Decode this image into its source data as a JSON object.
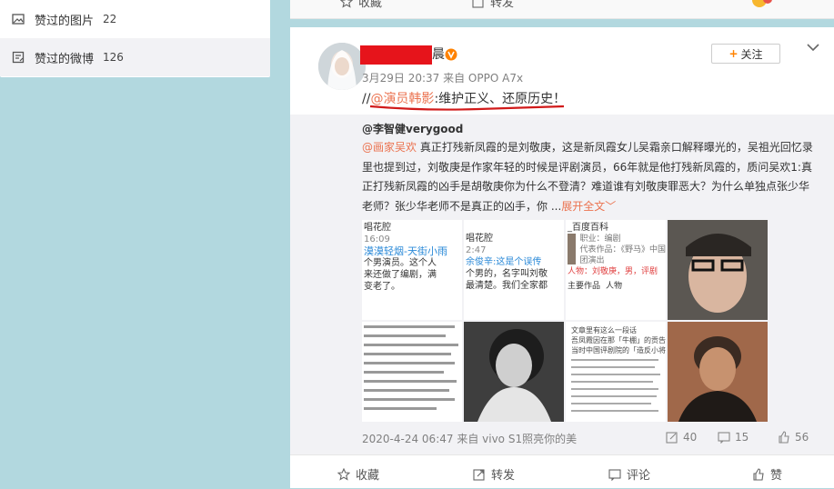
{
  "sidebar": {
    "items": [
      {
        "label": "赞过的图片",
        "count": "22",
        "icon": "image-icon"
      },
      {
        "label": "赞过的微博",
        "count": "126",
        "icon": "post-icon"
      }
    ]
  },
  "prev_card": {
    "favorite_label": "收藏",
    "repost_label": "转发"
  },
  "post": {
    "name_suffix": "晨",
    "meta": "3月29日 20:37 来自 OPPO A7x",
    "follow_label": "关注",
    "text_prefix": "//",
    "mention": "@演员韩影",
    "text_body": ":维护正义、还原历史！",
    "repost": {
      "author": "@李智健verygood",
      "mention": "@画家吴欢",
      "text": " 真正打残新凤霞的是刘敬庚，这是新凤霞女儿吴霜亲口解释曝光的，吴祖光回忆录里也提到过，刘敬庚是作家年轻的时候是评剧演员，66年就是他打残新凤霞的，质问吴欢1:真正打残新凤霞的凶手是胡敬庚你为什么不登清？难道谁有刘敬庚罪恶大？为什么单独点张少华老师？张少华老师不是真正的凶手，你 ...",
      "more_label": "展开全文",
      "more_arrow": "﹀",
      "footer": "2020-4-24 06:47 来自 vivo S1照亮你的美",
      "reposts": "40",
      "comments": "15",
      "likes": "56"
    },
    "thumbs": {
      "t1": {
        "l1": "唱花腔",
        "l2": "16:09",
        "l3": "漠漠轻烟-天街小雨",
        "l4": "个男演员。这个人",
        "l5": "来还做了编剧，满",
        "l6": "变老了。"
      },
      "t2": {
        "l1": "唱花腔",
        "l2": "2:47",
        "l3": "余俊辛:这是个误传",
        "l4": "个男的，名字叫刘敬",
        "l5": "最清楚。我们全家都"
      },
      "t3": {
        "l1": "_百度百科",
        "l2": "职业：编剧",
        "l3": "代表作品：《野马》中国",
        "l4": "团演出",
        "l5": "人物：刘敬庚，男，评剧",
        "l6": "主要作品",
        "l7": "人物"
      },
      "t7": {
        "l1": "文章里有这么一段话",
        "l2": "吾凤霞因在那「牛棚」的贡告，她是",
        "l3": "当时中国评剧院的「造反小将」学习主教"
      }
    },
    "actions": {
      "favorite": "收藏",
      "repost": "转发",
      "comment": "评论",
      "like": "赞"
    }
  },
  "colors": {
    "accent": "#eb7350",
    "follow_plus": "#ff8200",
    "name_mask": "#e6141b",
    "background": "#b2d8df"
  }
}
